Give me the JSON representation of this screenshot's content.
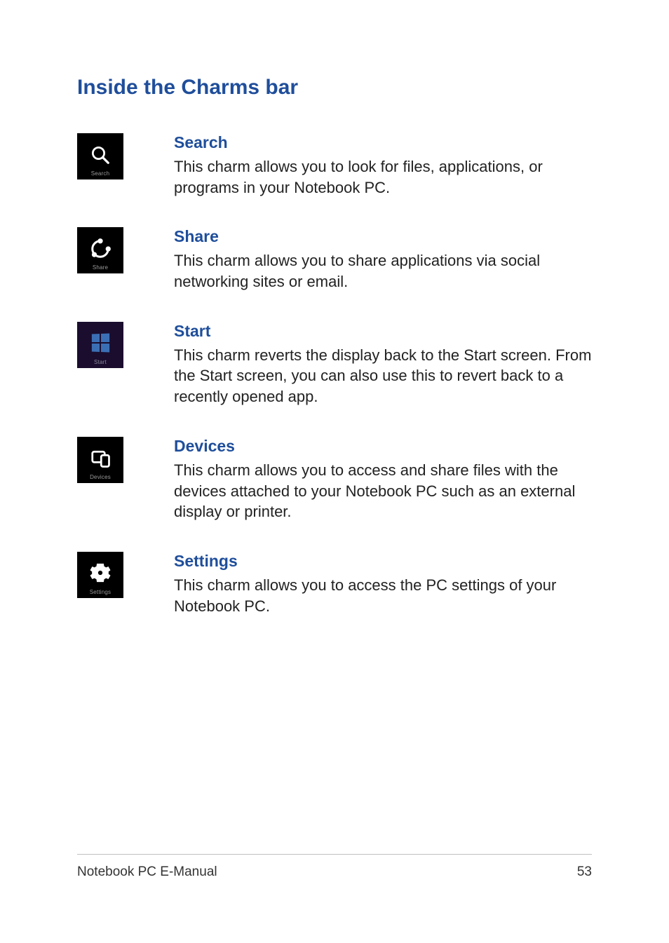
{
  "section_title": "Inside the Charms bar",
  "charms": [
    {
      "heading": "Search",
      "tile_label": "Search",
      "description": "This charm allows you to look for files, applications, or programs in your Notebook PC."
    },
    {
      "heading": "Share",
      "tile_label": "Share",
      "description": "This charm allows you to share applications via social networking sites or email."
    },
    {
      "heading": "Start",
      "tile_label": "Start",
      "description": "This charm reverts the display back to the Start screen. From the Start screen, you can also use this to revert back to a recently opened app."
    },
    {
      "heading": "Devices",
      "tile_label": "Devices",
      "description": "This charm allows you to access and share files with the devices attached to your Notebook PC such as an external display or printer."
    },
    {
      "heading": "Settings",
      "tile_label": "Settings",
      "description": "This charm allows you to access the PC settings of your Notebook PC."
    }
  ],
  "footer": {
    "doc_title": "Notebook PC E-Manual",
    "page_number": "53"
  }
}
